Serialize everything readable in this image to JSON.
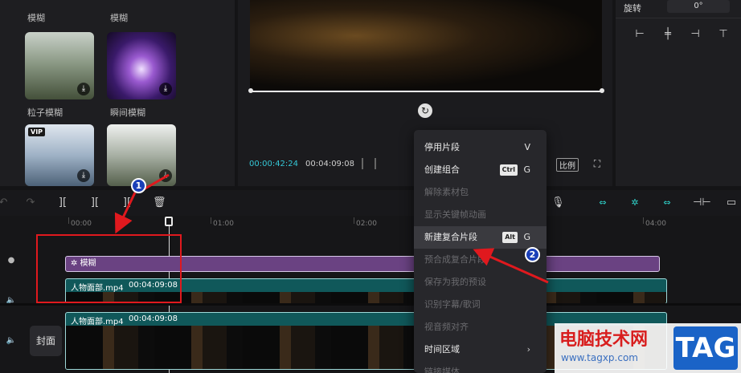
{
  "effects": {
    "cards": [
      {
        "label": "模糊"
      },
      {
        "label": "模糊"
      },
      {
        "label": "粒子模糊"
      },
      {
        "label": "瞬间模糊"
      },
      {
        "label": "",
        "vip": "VIP"
      },
      {
        "label": ""
      }
    ]
  },
  "preview": {
    "time_current": "00:00:42:24",
    "time_total": "00:04:09:08",
    "ratio_label": "比例"
  },
  "attrs": {
    "rotate_label": "旋转",
    "rotate_value": "0°"
  },
  "timeline": {
    "ticks": [
      "00:00",
      "01:00",
      "02:00",
      "04:00"
    ],
    "effect_clip_label": "模糊",
    "clip1_name": "人物面部.mp4",
    "clip1_duration": "00:04:09:08",
    "clip2_name": "人物面部.mp4",
    "clip2_duration": "00:04:09:08",
    "cover_label": "封面"
  },
  "context_menu": {
    "items": [
      {
        "label": "停用片段",
        "key": "V"
      },
      {
        "label": "创建组合",
        "mod": "Ctrl",
        "key": "G"
      },
      {
        "label": "解除素材包"
      },
      {
        "label": "显示关键帧动画"
      },
      {
        "label": "新建复合片段",
        "mod": "Alt",
        "key": "G"
      },
      {
        "label": "预合成复合片段"
      },
      {
        "label": "保存为我的预设"
      },
      {
        "label": "识别字幕/歌词"
      },
      {
        "label": "视音频对齐"
      },
      {
        "label": "时间区域"
      },
      {
        "label": "链接媒体"
      }
    ]
  },
  "annotations": {
    "marker1": "1",
    "marker2": "2"
  },
  "watermark": {
    "title": "电脑技术网",
    "url": "www.tagxp.com",
    "tag": "TAG"
  }
}
